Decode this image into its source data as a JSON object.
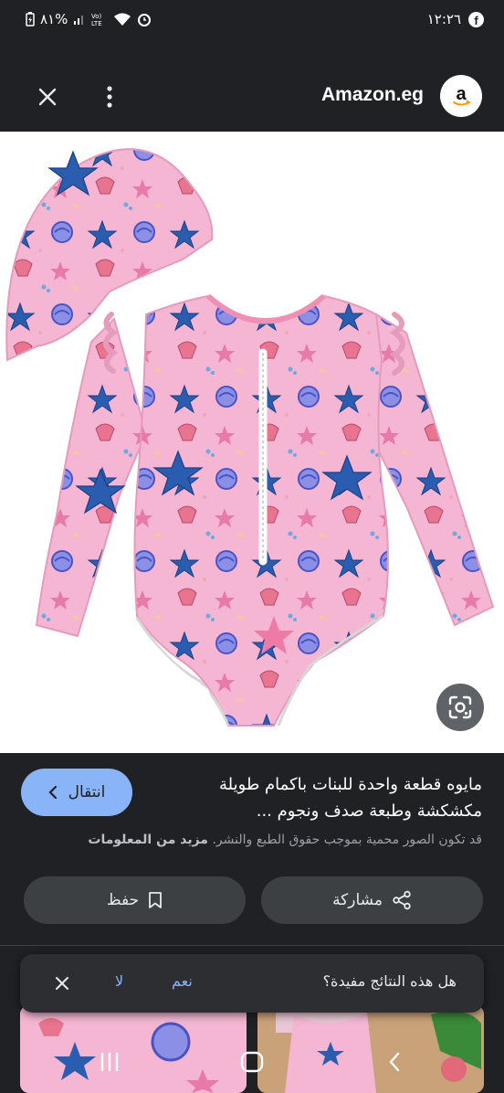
{
  "status_bar": {
    "battery": "٨١%",
    "time": "١٢:٢٦",
    "network": "Vo LTE"
  },
  "top_bar": {
    "site_name": "Amazon.eg",
    "logo_letter": "a"
  },
  "result": {
    "visit_label": "انتقال",
    "title": "مايوه قطعة واحدة للبنات باكمام طويلة مكشكشة وطبعة صدف ونجوم ...",
    "copyright_text": "قد تكون الصور محمية بموجب حقوق الطبع والنشر.",
    "learn_more": "مزيد من المعلومات",
    "share_label": "مشاركة",
    "save_label": "حفظ"
  },
  "feedback": {
    "question": "هل هذه النتائج مفيدة؟",
    "yes": "نعم",
    "no": "لا"
  },
  "colors": {
    "accent": "#8ab4f8",
    "background": "#202124",
    "button": "#3c4043",
    "swimsuit_pink": "#f4b6d2",
    "starfish_blue": "#2a5db0",
    "shell_pink": "#e8748f"
  },
  "icons": [
    "close-icon",
    "more-vert-icon",
    "amazon-logo",
    "lens-icon",
    "share-icon",
    "bookmark-icon",
    "chevron-left-icon",
    "recents-icon",
    "home-icon",
    "back-icon"
  ]
}
